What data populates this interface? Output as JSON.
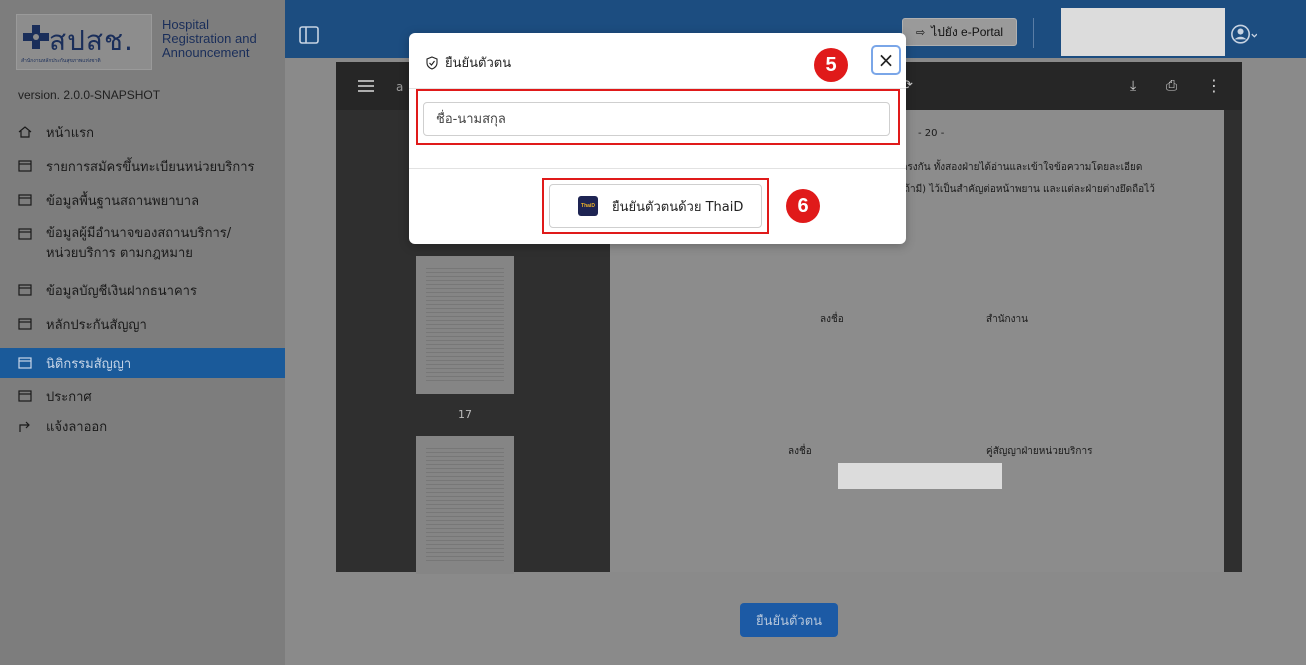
{
  "sidebar": {
    "logo_thai": "สปสช.",
    "logo_sub": "สำนักงานหลักประกันสุขภาพแห่งชาติ",
    "logo_en": [
      "Hospital",
      "Registration and",
      "Announcement"
    ],
    "version": "version. 2.0.0-SNAPSHOT",
    "items": [
      {
        "label": "หน้าแรก",
        "icon": "home-icon"
      },
      {
        "label": "รายการสมัครขึ้นทะเบียนหน่วยบริการ",
        "icon": "form-icon"
      },
      {
        "label": "ข้อมูลพื้นฐานสถานพยาบาล",
        "icon": "form-icon"
      },
      {
        "label": "ข้อมูลผู้มีอำนาจของสถานบริการ/ หน่วยบริการ ตามกฎหมาย",
        "icon": "form-icon"
      },
      {
        "label": "ข้อมูลบัญชีเงินฝากธนาคาร",
        "icon": "form-icon"
      },
      {
        "label": "หลักประกันสัญญา",
        "icon": "form-icon"
      },
      {
        "label": "นิติกรรมสัญญา",
        "icon": "form-icon",
        "active": true
      },
      {
        "label": "ประกาศ",
        "icon": "form-icon"
      },
      {
        "label": "แจ้งลาออก",
        "icon": "logout-icon"
      }
    ]
  },
  "topbar": {
    "portal_label": "ไปยัง e-Portal"
  },
  "pdf": {
    "toolbar_name": "a",
    "thumb_page": "17",
    "page_number": "- 20 -",
    "line1": "องตรงกัน ทั้งสองฝ่ายได้อ่านและเข้าใจข้อความโดยละเอียด",
    "line2": "(ถ้ามี) ไว้เป็นสำคัญต่อหน้าพยาน และแต่ละฝ่ายต่างยึดถือไว้",
    "sign1": "ลงชื่อ",
    "office": "สำนักงาน",
    "sign2": "ลงชื่อ",
    "party": "คู่สัญญาฝ่ายหน่วยบริการ"
  },
  "confirm_button": "ยืนยันตัวตน",
  "modal": {
    "title": "ยืนยันตัวตน",
    "close": "×",
    "name_placeholder": "ชื่อ-นามสกุล",
    "thaid_label": "ยืนยันตัวตนด้วย ThaiD",
    "thaid_logo_text": "ThaiD"
  },
  "annotations": {
    "step5": "5",
    "step6": "6"
  },
  "colors": {
    "accent": "#1c4d80",
    "highlight": "#e01a1a"
  }
}
